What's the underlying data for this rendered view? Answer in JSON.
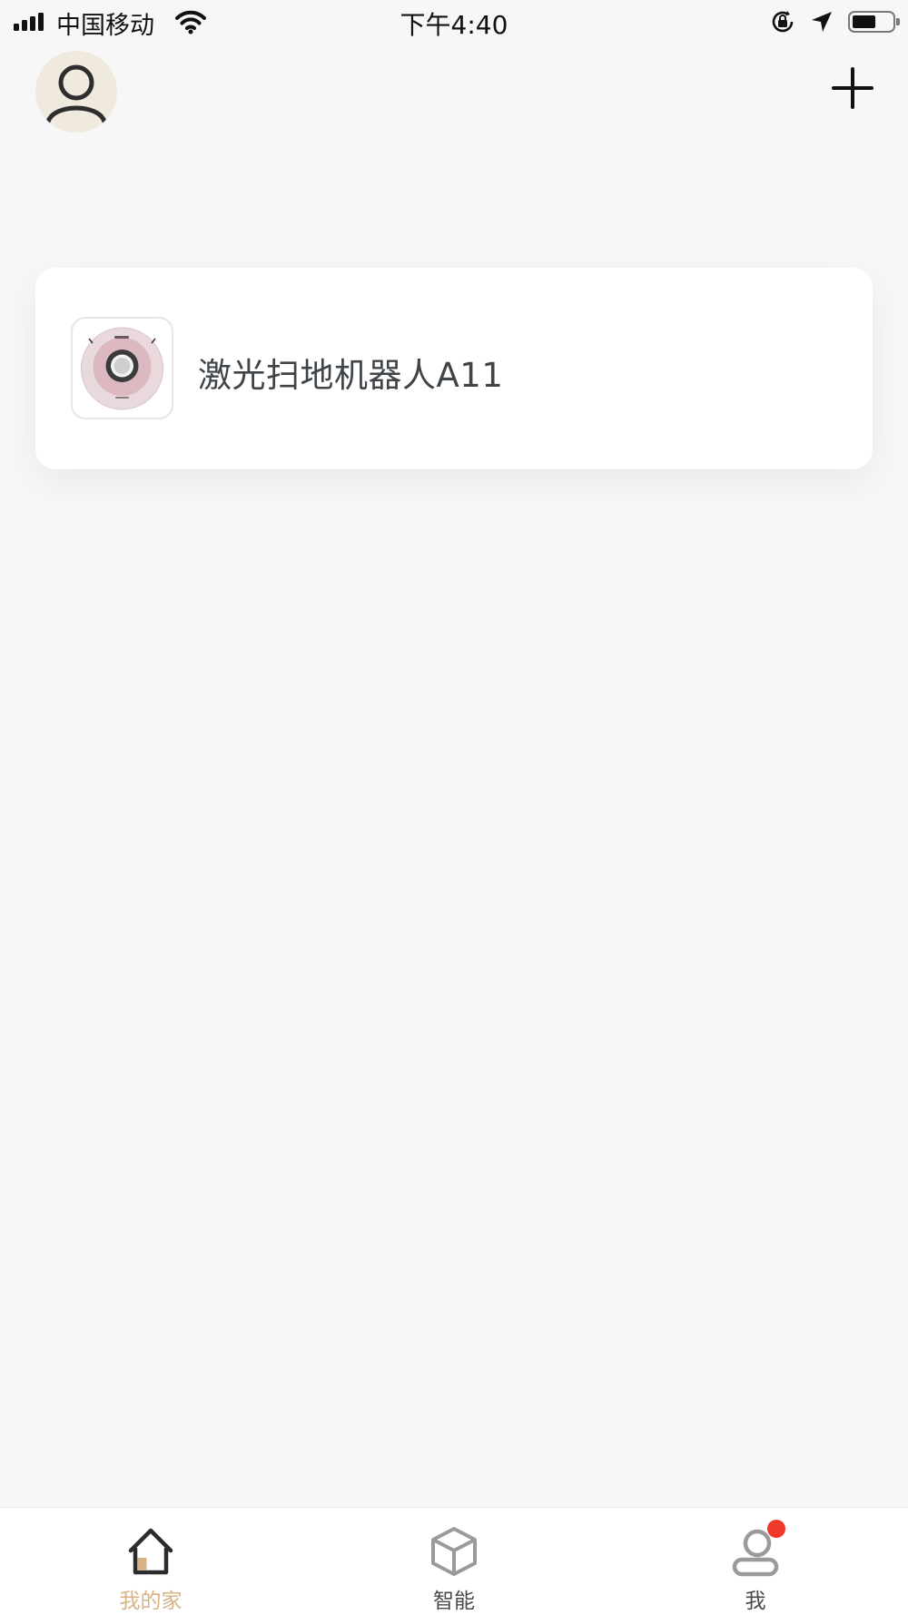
{
  "status_bar": {
    "carrier": "中国移动",
    "time": "下午4:40",
    "battery_level": 0.6
  },
  "header": {
    "avatar_icon": "user-avatar-icon",
    "add_icon": "plus-icon"
  },
  "device_card": {
    "name": "激光扫地机器人A11",
    "image_icon": "robot-vacuum-image"
  },
  "tab_bar": {
    "tabs": [
      {
        "label": "我的家",
        "icon": "home-icon",
        "active": true
      },
      {
        "label": "智能",
        "icon": "cube-icon",
        "active": false
      },
      {
        "label": "我",
        "icon": "profile-icon",
        "active": false,
        "badge": true
      }
    ]
  },
  "colors": {
    "accent": "#d7b387",
    "badge": "#f0392b",
    "background": "#f7f7f7",
    "avatar_bg": "#efe9de"
  }
}
